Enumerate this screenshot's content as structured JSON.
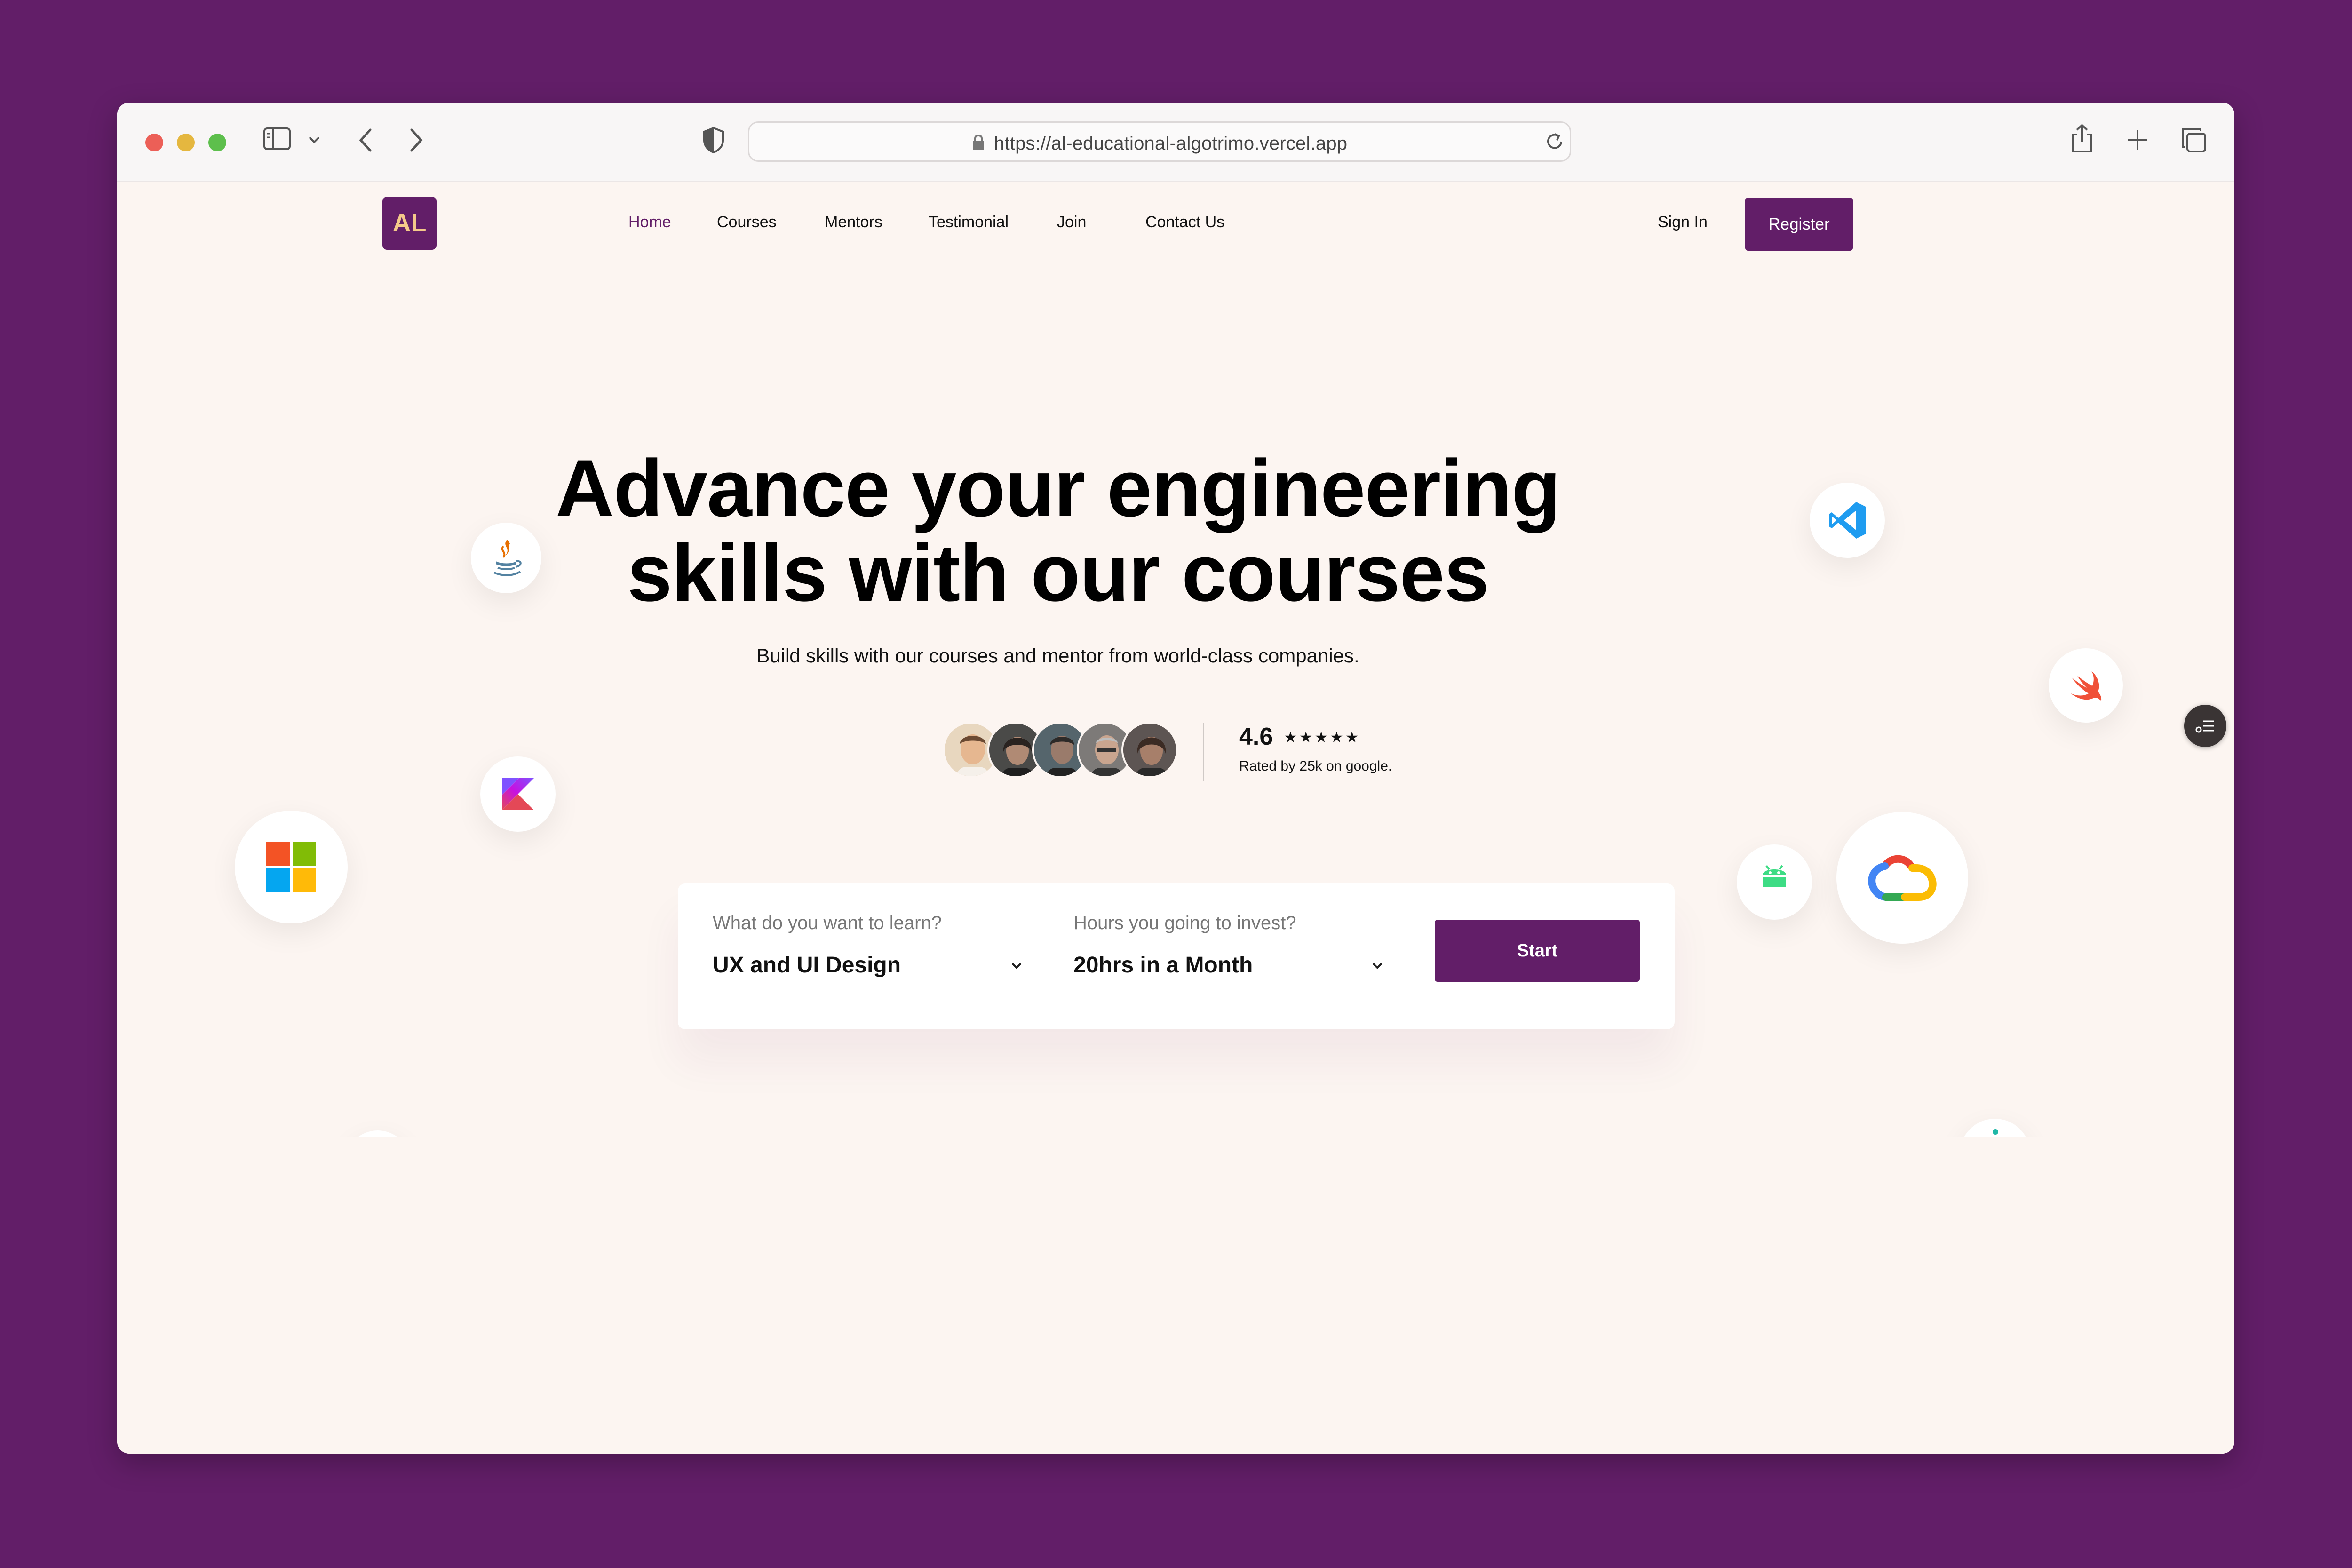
{
  "browser": {
    "url": "https://al-educational-algotrimo.vercel.app"
  },
  "nav": {
    "logo": "AL",
    "links": [
      "Home",
      "Courses",
      "Mentors",
      "Testimonial",
      "Join",
      "Contact Us"
    ],
    "sign_in": "Sign In",
    "register": "Register"
  },
  "hero": {
    "title_line1": "Advance your engineering",
    "title_line2": "skills with our courses",
    "subtitle": "Build skills with our courses and mentor from world-class companies."
  },
  "rating": {
    "value": "4.6",
    "stars": "★★★★★",
    "note": "Rated by 25k on google."
  },
  "search": {
    "learn_label": "What do you want to learn?",
    "learn_value": "UX and UI Design",
    "hours_label": "Hours you going to invest?",
    "hours_value": "20hrs in a Month",
    "start": "Start"
  },
  "icons": [
    "java-icon",
    "kotlin-icon",
    "microsoft-icon",
    "vscode-icon",
    "swift-icon",
    "google-cloud-icon",
    "android-icon"
  ],
  "colors": {
    "brand": "#621e68",
    "logo_text": "#f4c98a",
    "page_bg": "#fcf5f1"
  }
}
